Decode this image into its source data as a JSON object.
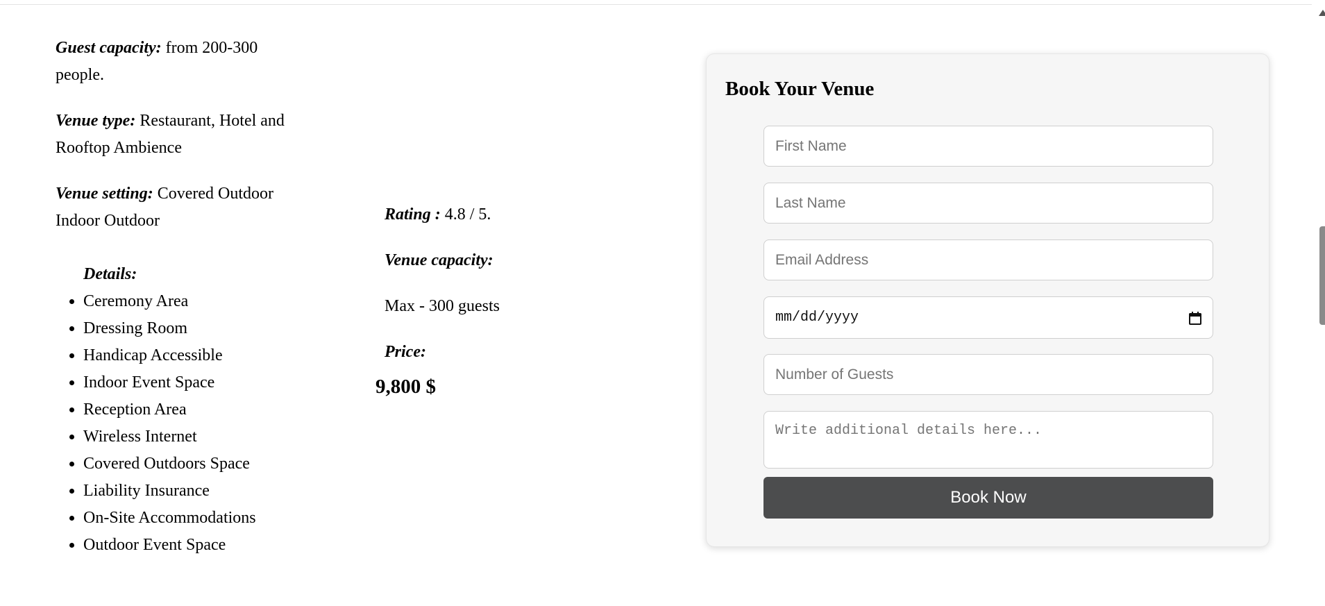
{
  "left": {
    "guest_capacity_label": "Guest capacity:",
    "guest_capacity_value": " from 200-300 people.",
    "venue_type_label": "Venue type:",
    "venue_type_value": " Restaurant, Hotel and Rooftop Ambience",
    "venue_setting_label": "Venue setting:",
    "venue_setting_value": " Covered Outdoor Indoor Outdoor",
    "details_title": "Details:",
    "details": [
      "Ceremony Area",
      "Dressing Room",
      "Handicap Accessible",
      "Indoor Event Space",
      "Reception Area",
      "Wireless Internet",
      "Covered Outdoors Space",
      "Liability Insurance",
      "On-Site Accommodations",
      "Outdoor Event Space"
    ]
  },
  "middle": {
    "rating_label": "Rating :",
    "rating_value": " 4.8 / 5.",
    "venue_capacity_label": "Venue capacity:",
    "venue_capacity_value": "Max - 300 guests",
    "price_label": "Price:",
    "price_value": "9,800 $"
  },
  "booking": {
    "title": "Book Your Venue",
    "first_name_placeholder": "First Name",
    "last_name_placeholder": "Last Name",
    "email_placeholder": "Email Address",
    "date_value": "mm/dd/yyyy",
    "guests_placeholder": "Number of Guests",
    "details_placeholder": "Write additional details here...",
    "button_label": "Book Now"
  }
}
